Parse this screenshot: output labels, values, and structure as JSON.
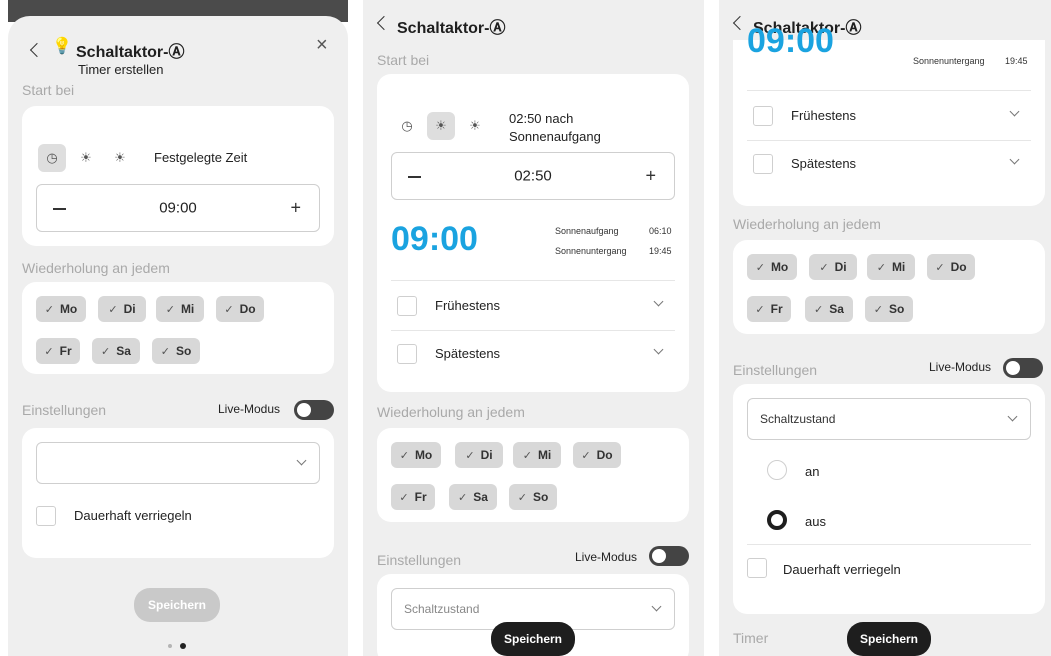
{
  "screens": [
    {
      "header": {
        "title": "Schaltaktor-Ⓐ",
        "subtitle": "Timer erstellen",
        "close": "×"
      },
      "start_label": "Start bei",
      "mode_text": "Festgelegte Zeit",
      "stepper": {
        "minus": "−",
        "value": "09:00",
        "plus": "+"
      },
      "repeat_label": "Wiederholung an jedem",
      "days": [
        "Mo",
        "Di",
        "Mi",
        "Do",
        "Fr",
        "Sa",
        "So"
      ],
      "settings_label": "Einstellungen",
      "live_mode_label": "Live-Modus",
      "select_value": "",
      "lock_label": "Dauerhaft verriegeln",
      "save_label": "Speichern"
    },
    {
      "header": {
        "title": "Schaltaktor-Ⓐ"
      },
      "start_label": "Start bei",
      "mode_text": "02:50 nach Sonnenaufgang",
      "stepper": {
        "minus": "−",
        "value": "02:50",
        "plus": "+"
      },
      "big_time": "09:00",
      "sunrise_label": "Sonnenaufgang",
      "sunrise_time": "06:10",
      "sunset_label": "Sonnenuntergang",
      "sunset_time": "19:45",
      "earliest_label": "Frühestens",
      "latest_label": "Spätestens",
      "repeat_label": "Wiederholung an jedem",
      "days": [
        "Mo",
        "Di",
        "Mi",
        "Do",
        "Fr",
        "Sa",
        "So"
      ],
      "settings_label": "Einstellungen",
      "live_mode_label": "Live-Modus",
      "select_placeholder": "Schaltzustand",
      "save_label": "Speichern"
    },
    {
      "header": {
        "title": "Schaltaktor-Ⓐ"
      },
      "big_time": "09:00",
      "sunset_label": "Sonnenuntergang",
      "sunset_time": "19:45",
      "earliest_label": "Frühestens",
      "latest_label": "Spätestens",
      "repeat_label": "Wiederholung an jedem",
      "days": [
        "Mo",
        "Di",
        "Mi",
        "Do",
        "Fr",
        "Sa",
        "So"
      ],
      "settings_label": "Einstellungen",
      "live_mode_label": "Live-Modus",
      "select_value": "Schaltzustand",
      "option_on": "an",
      "option_off": "aus",
      "lock_label": "Dauerhaft verriegeln",
      "timer_label": "Timer",
      "save_label": "Speichern"
    }
  ],
  "icons": {
    "check": "✓",
    "clock": "◷",
    "sunrise": "☀",
    "sunset": "☀"
  },
  "colors": {
    "accent": "#1aa3e0",
    "chip": "#d8d8d8",
    "dark": "#1e1e1e"
  }
}
